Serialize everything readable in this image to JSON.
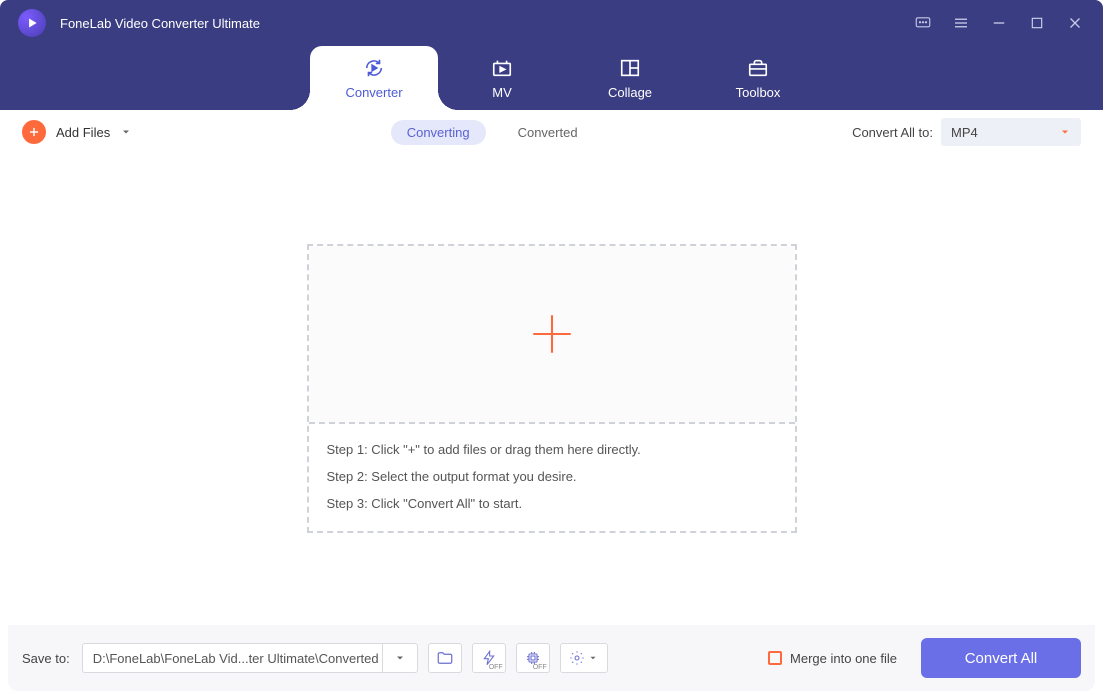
{
  "app_title": "FoneLab Video Converter Ultimate",
  "tabs": {
    "converter": "Converter",
    "mv": "MV",
    "collage": "Collage",
    "toolbox": "Toolbox",
    "active": "converter"
  },
  "toolbar": {
    "add_files": "Add Files",
    "status": {
      "converting": "Converting",
      "converted": "Converted",
      "active": "converting"
    },
    "convert_all_to_label": "Convert All to:",
    "format_selected": "MP4"
  },
  "dropzone": {
    "steps": [
      "Step 1: Click \"+\" to add files or drag them here directly.",
      "Step 2: Select the output format you desire.",
      "Step 3: Click \"Convert All\" to start."
    ]
  },
  "footer": {
    "save_to_label": "Save to:",
    "save_path": "D:\\FoneLab\\FoneLab Vid...ter Ultimate\\Converted",
    "hw_off": "OFF",
    "gpu_off": "OFF",
    "merge_label": "Merge into one file",
    "convert_all": "Convert All"
  }
}
